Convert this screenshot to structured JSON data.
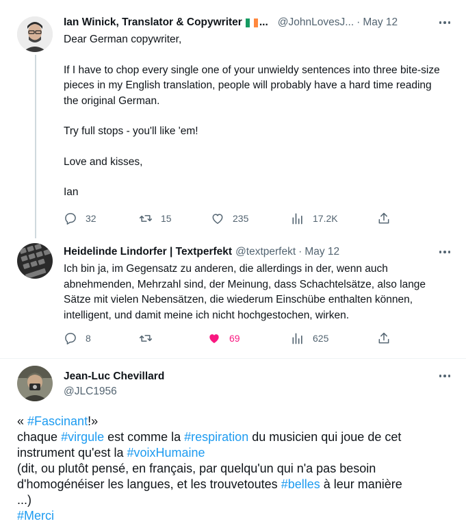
{
  "tweets": [
    {
      "author": "Ian Winick, Translator & Copywriter",
      "author_trail": "...",
      "handle": "@JohnLovesJ...",
      "sep": "·",
      "date": "May 12",
      "body": [
        "Dear German copywriter,",
        "If I have to chop every single one of your unwieldy sentences into three bite-size pieces in my English translation, people will probably have a hard time reading the original German.",
        "Try full stops - you'll like 'em!",
        "Love and kisses,",
        "Ian"
      ],
      "stats": {
        "replies": "32",
        "retweets": "15",
        "likes": "235",
        "views": "17.2K"
      }
    },
    {
      "author": "Heidelinde Lindorfer | Textperfekt",
      "handle": "@textperfekt",
      "sep": "·",
      "date": "May 12",
      "body": "Ich bin ja, im Gegensatz zu anderen, die allerdings in der, wenn auch abnehmenden, Mehrzahl sind, der Meinung, dass Schachtelsätze, also lange Sätze mit vielen Nebensätzen, die wiederum Einschübe enthalten können, intelligent, und damit meine ich nicht hochgestochen, wirken.",
      "stats": {
        "replies": "8",
        "retweets": "",
        "likes": "69",
        "views": "625"
      }
    },
    {
      "author": "Jean-Luc Chevillard",
      "handle": "@JLC1956",
      "body_parts": {
        "l1_a": "« ",
        "l1_tag": "#Fascinant",
        "l1_b": "!»",
        "l2_a": "chaque ",
        "l2_tag1": "#virgule",
        "l2_b": " est comme la ",
        "l2_tag2": "#respiration",
        "l2_c": " du musicien qui joue de cet",
        "l3_a": "instrument qu'est la ",
        "l3_tag": "#voixHumaine",
        "l4": " (dit, ou plutôt pensé, en français, par quelqu'un qui n'a pas besoin",
        "l5_a": "d'homogénéiser les langues, et les trouvetoutes ",
        "l5_tag": "#belles",
        "l5_b": " à leur manière",
        "l6": "...)",
        "l7_tag": "#Merci"
      }
    }
  ],
  "colors": {
    "text": "#0f1419",
    "secondary": "#536471",
    "link": "#1d9bf0",
    "like": "#f91880",
    "thread_line": "#cfd9de"
  },
  "icons": [
    "reply-icon",
    "retweet-icon",
    "like-icon",
    "views-icon",
    "share-icon",
    "more-icon",
    "ireland-flag-icon"
  ]
}
